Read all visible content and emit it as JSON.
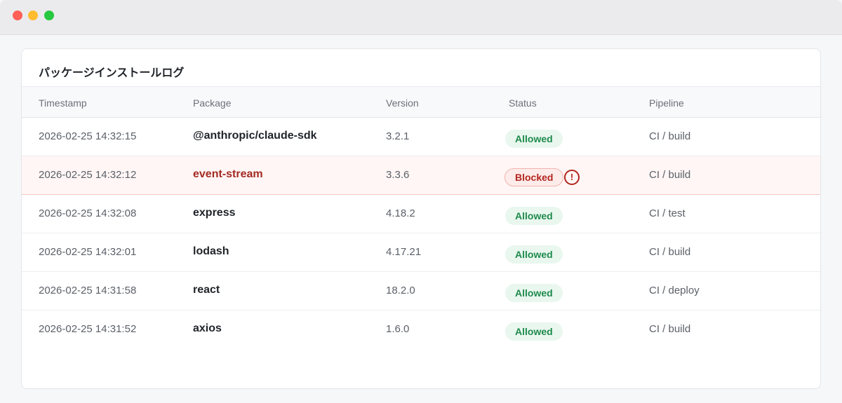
{
  "card": {
    "title": "パッケージインストールログ"
  },
  "table": {
    "headers": [
      "Timestamp",
      "Package",
      "Version",
      "Status",
      "Pipeline"
    ],
    "rows": [
      {
        "timestamp": "2026-02-25 14:32:15",
        "package": "@anthropic/claude-sdk",
        "version": "3.2.1",
        "status": "Allowed",
        "pipeline": "CI / build"
      },
      {
        "timestamp": "2026-02-25 14:32:12",
        "package": "event-stream",
        "version": "3.3.6",
        "status": "Blocked",
        "pipeline": "CI / build"
      },
      {
        "timestamp": "2026-02-25 14:32:08",
        "package": "express",
        "version": "4.18.2",
        "status": "Allowed",
        "pipeline": "CI / test"
      },
      {
        "timestamp": "2026-02-25 14:32:01",
        "package": "lodash",
        "version": "4.17.21",
        "status": "Allowed",
        "pipeline": "CI / build"
      },
      {
        "timestamp": "2026-02-25 14:31:58",
        "package": "react",
        "version": "18.2.0",
        "status": "Allowed",
        "pipeline": "CI / deploy"
      },
      {
        "timestamp": "2026-02-25 14:31:52",
        "package": "axios",
        "version": "1.6.0",
        "status": "Allowed",
        "pipeline": "CI / build"
      }
    ]
  },
  "icons": {
    "alert": "!"
  },
  "colors": {
    "allowed_text": "#1f8a4c",
    "allowed_bg": "#e9f7ef",
    "blocked_text": "#b3261e",
    "blocked_bg": "#fdecea",
    "blocked_row_bg": "#fff6f5"
  }
}
